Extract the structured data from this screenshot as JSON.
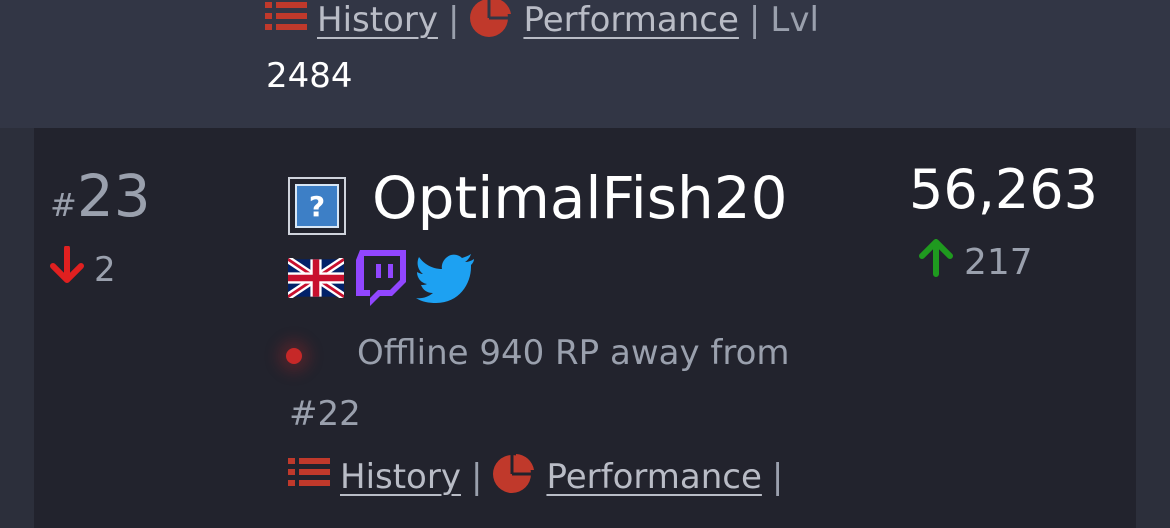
{
  "previous": {
    "history_label": "History",
    "performance_label": "Performance",
    "separator": "|",
    "lvl_label": "Lvl",
    "lvl_value": "2484"
  },
  "player": {
    "rank_hash": "#",
    "rank": "23",
    "rank_change": "2",
    "rank_change_direction": "down",
    "avatar_placeholder": "?",
    "name": "OptimalFish20",
    "score": "56,263",
    "score_change": "217",
    "score_change_direction": "up",
    "flag": "uk-flag",
    "socials": [
      "twitch-icon",
      "twitter-icon"
    ],
    "status_text": "Offline 940 RP away from",
    "status_target": "#22",
    "history_label": "History",
    "performance_label": "Performance",
    "separator": "|"
  },
  "colors": {
    "background": "#2c2f3b",
    "card": "#22232d",
    "down": "#e02020",
    "up": "#1f9a1f",
    "offline": "#c62828",
    "link_icon": "#c0392b",
    "twitch": "#9146ff",
    "twitter": "#1da1f2"
  }
}
